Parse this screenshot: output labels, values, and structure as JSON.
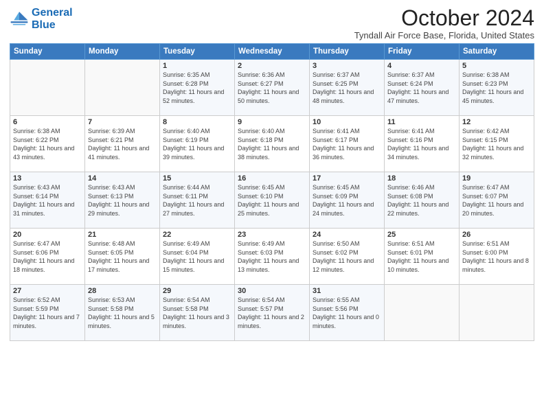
{
  "logo": {
    "line1": "General",
    "line2": "Blue"
  },
  "title": "October 2024",
  "location": "Tyndall Air Force Base, Florida, United States",
  "days_of_week": [
    "Sunday",
    "Monday",
    "Tuesday",
    "Wednesday",
    "Thursday",
    "Friday",
    "Saturday"
  ],
  "weeks": [
    [
      {
        "day": "",
        "info": ""
      },
      {
        "day": "",
        "info": ""
      },
      {
        "day": "1",
        "info": "Sunrise: 6:35 AM\nSunset: 6:28 PM\nDaylight: 11 hours and 52 minutes."
      },
      {
        "day": "2",
        "info": "Sunrise: 6:36 AM\nSunset: 6:27 PM\nDaylight: 11 hours and 50 minutes."
      },
      {
        "day": "3",
        "info": "Sunrise: 6:37 AM\nSunset: 6:25 PM\nDaylight: 11 hours and 48 minutes."
      },
      {
        "day": "4",
        "info": "Sunrise: 6:37 AM\nSunset: 6:24 PM\nDaylight: 11 hours and 47 minutes."
      },
      {
        "day": "5",
        "info": "Sunrise: 6:38 AM\nSunset: 6:23 PM\nDaylight: 11 hours and 45 minutes."
      }
    ],
    [
      {
        "day": "6",
        "info": "Sunrise: 6:38 AM\nSunset: 6:22 PM\nDaylight: 11 hours and 43 minutes."
      },
      {
        "day": "7",
        "info": "Sunrise: 6:39 AM\nSunset: 6:21 PM\nDaylight: 11 hours and 41 minutes."
      },
      {
        "day": "8",
        "info": "Sunrise: 6:40 AM\nSunset: 6:19 PM\nDaylight: 11 hours and 39 minutes."
      },
      {
        "day": "9",
        "info": "Sunrise: 6:40 AM\nSunset: 6:18 PM\nDaylight: 11 hours and 38 minutes."
      },
      {
        "day": "10",
        "info": "Sunrise: 6:41 AM\nSunset: 6:17 PM\nDaylight: 11 hours and 36 minutes."
      },
      {
        "day": "11",
        "info": "Sunrise: 6:41 AM\nSunset: 6:16 PM\nDaylight: 11 hours and 34 minutes."
      },
      {
        "day": "12",
        "info": "Sunrise: 6:42 AM\nSunset: 6:15 PM\nDaylight: 11 hours and 32 minutes."
      }
    ],
    [
      {
        "day": "13",
        "info": "Sunrise: 6:43 AM\nSunset: 6:14 PM\nDaylight: 11 hours and 31 minutes."
      },
      {
        "day": "14",
        "info": "Sunrise: 6:43 AM\nSunset: 6:13 PM\nDaylight: 11 hours and 29 minutes."
      },
      {
        "day": "15",
        "info": "Sunrise: 6:44 AM\nSunset: 6:11 PM\nDaylight: 11 hours and 27 minutes."
      },
      {
        "day": "16",
        "info": "Sunrise: 6:45 AM\nSunset: 6:10 PM\nDaylight: 11 hours and 25 minutes."
      },
      {
        "day": "17",
        "info": "Sunrise: 6:45 AM\nSunset: 6:09 PM\nDaylight: 11 hours and 24 minutes."
      },
      {
        "day": "18",
        "info": "Sunrise: 6:46 AM\nSunset: 6:08 PM\nDaylight: 11 hours and 22 minutes."
      },
      {
        "day": "19",
        "info": "Sunrise: 6:47 AM\nSunset: 6:07 PM\nDaylight: 11 hours and 20 minutes."
      }
    ],
    [
      {
        "day": "20",
        "info": "Sunrise: 6:47 AM\nSunset: 6:06 PM\nDaylight: 11 hours and 18 minutes."
      },
      {
        "day": "21",
        "info": "Sunrise: 6:48 AM\nSunset: 6:05 PM\nDaylight: 11 hours and 17 minutes."
      },
      {
        "day": "22",
        "info": "Sunrise: 6:49 AM\nSunset: 6:04 PM\nDaylight: 11 hours and 15 minutes."
      },
      {
        "day": "23",
        "info": "Sunrise: 6:49 AM\nSunset: 6:03 PM\nDaylight: 11 hours and 13 minutes."
      },
      {
        "day": "24",
        "info": "Sunrise: 6:50 AM\nSunset: 6:02 PM\nDaylight: 11 hours and 12 minutes."
      },
      {
        "day": "25",
        "info": "Sunrise: 6:51 AM\nSunset: 6:01 PM\nDaylight: 11 hours and 10 minutes."
      },
      {
        "day": "26",
        "info": "Sunrise: 6:51 AM\nSunset: 6:00 PM\nDaylight: 11 hours and 8 minutes."
      }
    ],
    [
      {
        "day": "27",
        "info": "Sunrise: 6:52 AM\nSunset: 5:59 PM\nDaylight: 11 hours and 7 minutes."
      },
      {
        "day": "28",
        "info": "Sunrise: 6:53 AM\nSunset: 5:58 PM\nDaylight: 11 hours and 5 minutes."
      },
      {
        "day": "29",
        "info": "Sunrise: 6:54 AM\nSunset: 5:58 PM\nDaylight: 11 hours and 3 minutes."
      },
      {
        "day": "30",
        "info": "Sunrise: 6:54 AM\nSunset: 5:57 PM\nDaylight: 11 hours and 2 minutes."
      },
      {
        "day": "31",
        "info": "Sunrise: 6:55 AM\nSunset: 5:56 PM\nDaylight: 11 hours and 0 minutes."
      },
      {
        "day": "",
        "info": ""
      },
      {
        "day": "",
        "info": ""
      }
    ]
  ]
}
